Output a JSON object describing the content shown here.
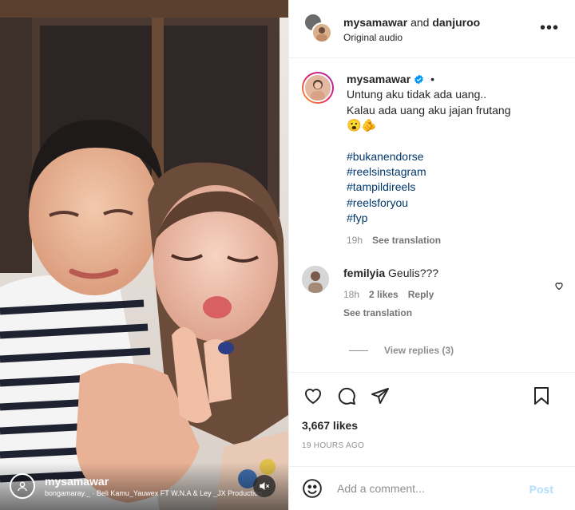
{
  "colors": {
    "link": "#00376b",
    "verified": "#0095f6",
    "post_disabled": "#b2dffc",
    "secondary_text": "#8e8e8e"
  },
  "media": {
    "username": "mysamawar",
    "audio_text": "bongamaray._ · Beli Kamu_Yauwex FT W.N.A & Ley _JX Production",
    "icons": {
      "user_tag": "user-tag-icon",
      "mute": "speaker-muted-icon"
    }
  },
  "header": {
    "user1": "mysamawar",
    "joiner": "and",
    "user2": "danjuroo",
    "subtitle": "Original audio",
    "more_icon": "more-horizontal-icon",
    "more_label": "•••"
  },
  "caption": {
    "username": "mysamawar",
    "dot": "•",
    "lines": [
      "Untung aku tidak ada uang..",
      "Kalau ada uang aku jajan frutang"
    ],
    "emojis": "😮🫵",
    "hashtags": [
      "#bukanendorse",
      "#reelsinstagram",
      "#tampildireels",
      "#reelsforyou",
      "#fyp"
    ],
    "time": "19h",
    "see_translation": "See translation"
  },
  "comments": [
    {
      "username": "femilyia",
      "text": "Geulis???",
      "time": "18h",
      "likes": "2 likes",
      "reply": "Reply",
      "see_translation": "See translation",
      "view_replies": "View replies (3)"
    }
  ],
  "actions": {
    "icons": [
      "heart-icon",
      "comment-icon",
      "share-icon",
      "bookmark-icon"
    ],
    "likes": "3,667 likes",
    "timestamp": "19 HOURS AGO"
  },
  "add_comment": {
    "placeholder": "Add a comment...",
    "post_label": "Post"
  }
}
